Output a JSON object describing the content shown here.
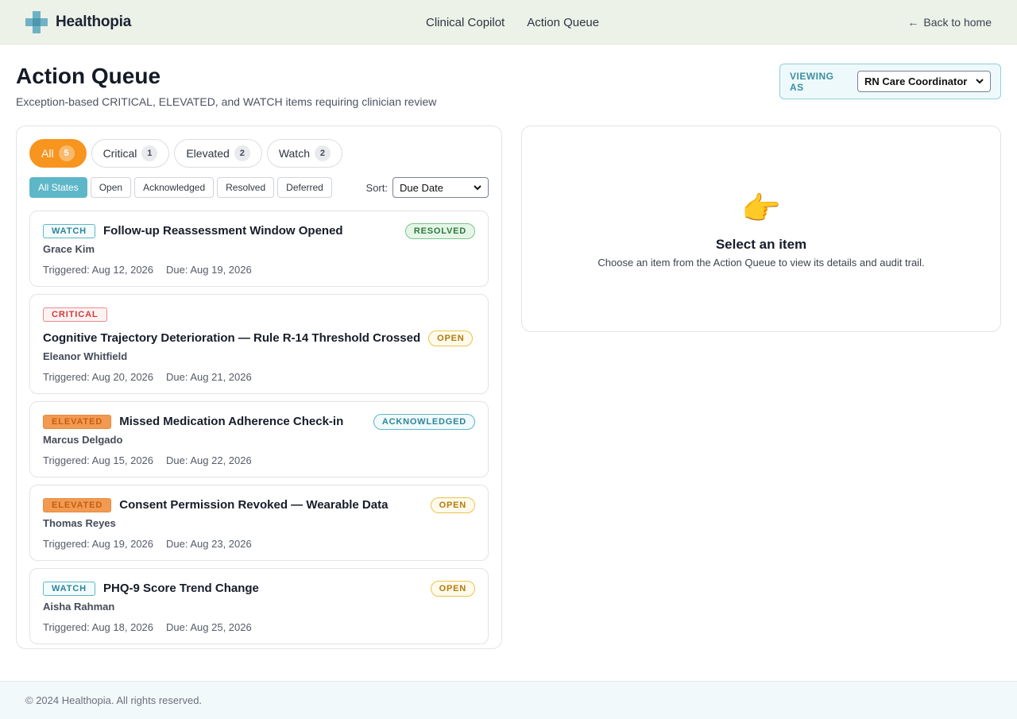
{
  "header": {
    "brand": "Healthopia",
    "nav": [
      "Clinical Copilot",
      "Action Queue"
    ],
    "back_arrow": "←",
    "back_label": "Back to home"
  },
  "page": {
    "title": "Action Queue",
    "subtitle": "Exception-based CRITICAL, ELEVATED, and WATCH items requiring clinician review"
  },
  "viewing_as": {
    "label": "VIEWING AS",
    "selected": "RN Care Coordinator"
  },
  "tabs": [
    {
      "label": "All",
      "count": "5"
    },
    {
      "label": "Critical",
      "count": "1"
    },
    {
      "label": "Elevated",
      "count": "2"
    },
    {
      "label": "Watch",
      "count": "2"
    }
  ],
  "state_filters": [
    "All States",
    "Open",
    "Acknowledged",
    "Resolved",
    "Deferred"
  ],
  "sort": {
    "label": "Sort:",
    "selected": "Due Date"
  },
  "items": [
    {
      "severity": "WATCH",
      "title": "Follow-up Reassessment Window Opened",
      "state": "RESOLVED",
      "patient": "Grace Kim",
      "triggered": "Triggered: Aug 12, 2026",
      "due": "Due: Aug 19, 2026"
    },
    {
      "severity": "CRITICAL",
      "title": "Cognitive Trajectory Deterioration — Rule R-14 Threshold Crossed",
      "state": "OPEN",
      "patient": "Eleanor Whitfield",
      "triggered": "Triggered: Aug 20, 2026",
      "due": "Due: Aug 21, 2026"
    },
    {
      "severity": "ELEVATED",
      "title": "Missed Medication Adherence Check-in",
      "state": "ACKNOWLEDGED",
      "patient": "Marcus Delgado",
      "triggered": "Triggered: Aug 15, 2026",
      "due": "Due: Aug 22, 2026"
    },
    {
      "severity": "ELEVATED",
      "title": "Consent Permission Revoked — Wearable Data",
      "state": "OPEN",
      "patient": "Thomas Reyes",
      "triggered": "Triggered: Aug 19, 2026",
      "due": "Due: Aug 23, 2026"
    },
    {
      "severity": "WATCH",
      "title": "PHQ-9 Score Trend Change",
      "state": "OPEN",
      "patient": "Aisha Rahman",
      "triggered": "Triggered: Aug 18, 2026",
      "due": "Due: Aug 25, 2026"
    }
  ],
  "detail": {
    "icon": "pointing-hand-icon",
    "title": "Select an item",
    "subtitle": "Choose an item from the Action Queue to view its details and audit trail."
  },
  "footer": "© 2024 Healthopia. All rights reserved.",
  "colors": {
    "accent_orange": "#f7951f",
    "accent_teal": "#5eb7c9",
    "header_bg": "#edf2e9"
  }
}
